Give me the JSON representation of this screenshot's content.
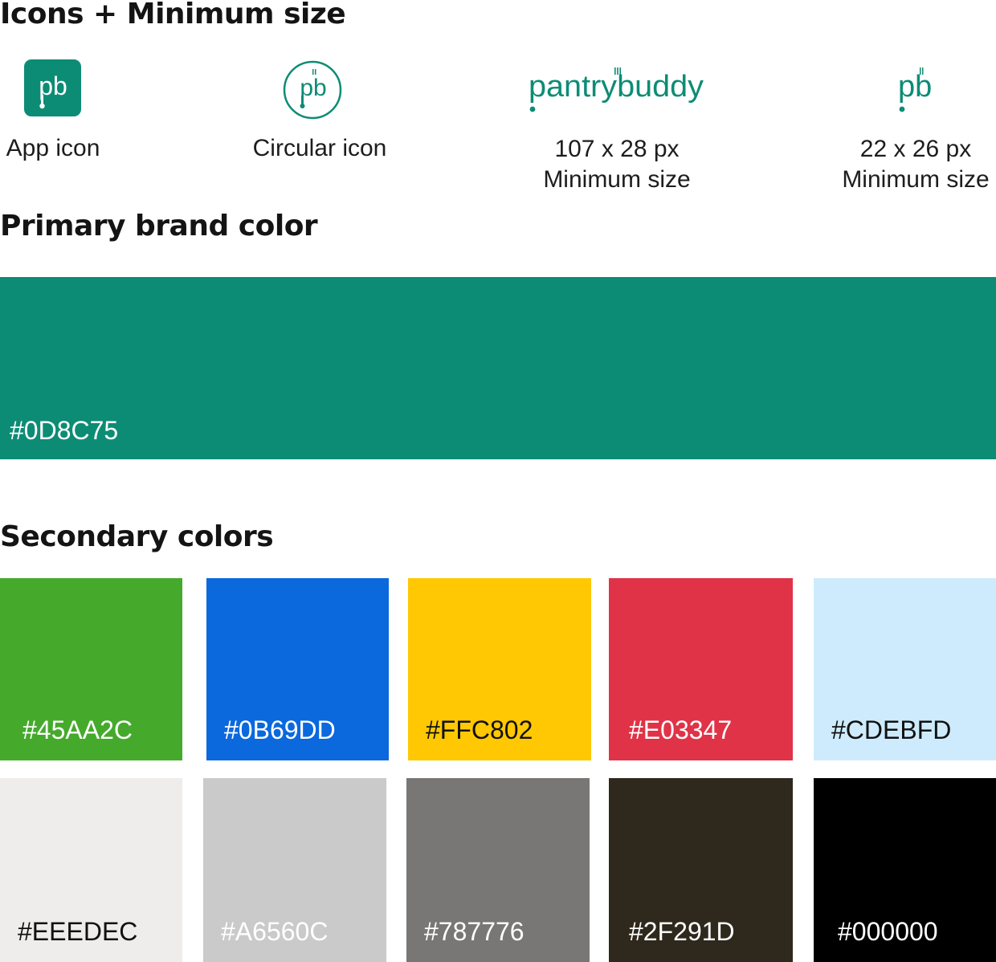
{
  "sections": {
    "icons_heading": "Icons + Minimum size",
    "primary_heading": "Primary brand color",
    "secondary_heading": "Secondary colors"
  },
  "icons": {
    "app_icon_label": "App icon",
    "circular_icon_label": "Circular icon",
    "wordmark": {
      "text_before": "pantry",
      "text_after": "buddy",
      "size": "107 x 28 px",
      "note": "Minimum size"
    },
    "monogram": {
      "text": "pb",
      "size": "22 x 26 px",
      "note": "Minimum size"
    }
  },
  "primary": {
    "hex": "#0D8C75",
    "color": "#0D8C75"
  },
  "secondary": {
    "row1": [
      {
        "hex": "#45AA2C",
        "color": "#45AA2C",
        "label_color": "#FFFFFF"
      },
      {
        "hex": "#0B69DD",
        "color": "#0B69DD",
        "label_color": "#FFFFFF"
      },
      {
        "hex": "#FFC802",
        "color": "#FFC802",
        "label_color": "#111111"
      },
      {
        "hex": "#E03347",
        "color": "#E03347",
        "label_color": "#FFFFFF"
      },
      {
        "hex": "#CDEBFD",
        "color": "#CDEBFD",
        "label_color": "#111111"
      }
    ],
    "row2": [
      {
        "hex": "#EEEDEC",
        "color": "#EEEDEC",
        "label_color": "#111111"
      },
      {
        "hex": "#A6560C",
        "color": "#CACACA",
        "label_color": "#FFFFFF"
      },
      {
        "hex": "#787776",
        "color": "#787776",
        "label_color": "#FFFFFF"
      },
      {
        "hex": "#2F291D",
        "color": "#2F291D",
        "label_color": "#FFFFFF"
      },
      {
        "hex": "#000000",
        "color": "#000000",
        "label_color": "#FFFFFF"
      }
    ]
  },
  "brand_color": "#0D8C75"
}
